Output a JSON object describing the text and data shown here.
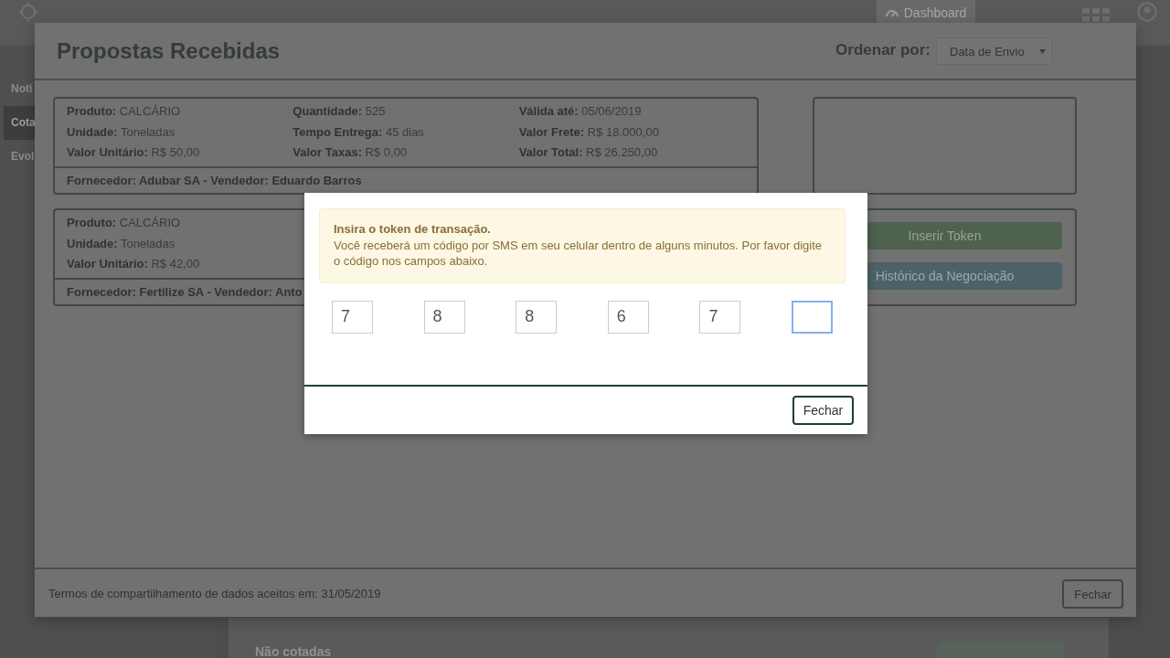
{
  "app": {
    "header": {
      "tabs": [
        {
          "label": "Dashboard",
          "selected": true
        }
      ]
    },
    "sidebar": {
      "items": [
        {
          "label": "Noti",
          "selected": false
        },
        {
          "label": "Cota",
          "selected": true
        },
        {
          "label": "Evol",
          "selected": false
        }
      ]
    },
    "panel": {
      "title": "Não cotadas"
    }
  },
  "proposals_dialog": {
    "title": "Propostas Recebidas",
    "sort": {
      "label": "Ordenar por:",
      "value": "Data de Envio"
    },
    "proposals": [
      {
        "columns": [
          [
            {
              "label": "Produto:",
              "value": "CALCÁRIO"
            },
            {
              "label": "Unidade:",
              "value": "Toneladas"
            },
            {
              "label": "Valor Unitário:",
              "value": "R$ 50,00"
            }
          ],
          [
            {
              "label": "Quantidade:",
              "value": "525"
            },
            {
              "label": "Tempo Entrega:",
              "value": "45 dias"
            },
            {
              "label": "Valor Taxas:",
              "value": "R$ 0,00"
            }
          ],
          [
            {
              "label": "Válida até:",
              "value": "05/06/2019"
            },
            {
              "label": "Valor Frete:",
              "value": "R$ 18.000,00"
            },
            {
              "label": "Valor Total:",
              "value": "R$ 26.250,00"
            }
          ]
        ],
        "supplier": "Fornecedor: Adubar SA - Vendedor: Eduardo Barros"
      },
      {
        "columns": [
          [
            {
              "label": "Produto:",
              "value": "CALCÁRIO"
            },
            {
              "label": "Unidade:",
              "value": "Toneladas"
            },
            {
              "label": "Valor Unitário:",
              "value": "R$ 42,00"
            }
          ]
        ],
        "supplier": "Fornecedor: Fertilize SA - Vendedor: Anto",
        "actions": [
          {
            "label": "Inserir Token",
            "kind": "success"
          },
          {
            "label": "Histórico da Negociação",
            "kind": "info"
          }
        ]
      }
    ],
    "terms": "Termos de compartilhamento de dados aceitos em: 31/05/2019",
    "close_button": "Fechar"
  },
  "token_dialog": {
    "title": "Insira o token de transação.",
    "message": "Você receberá um código por SMS em seu celular dentro de alguns minutos. Por favor digite o código nos campos abaixo.",
    "digits": [
      {
        "value": "7",
        "focused": false
      },
      {
        "value": "8",
        "focused": false
      },
      {
        "value": "8",
        "focused": false
      },
      {
        "value": "6",
        "focused": false
      },
      {
        "value": "7",
        "focused": false
      },
      {
        "focused": true
      }
    ],
    "close_button": "Fechar"
  }
}
